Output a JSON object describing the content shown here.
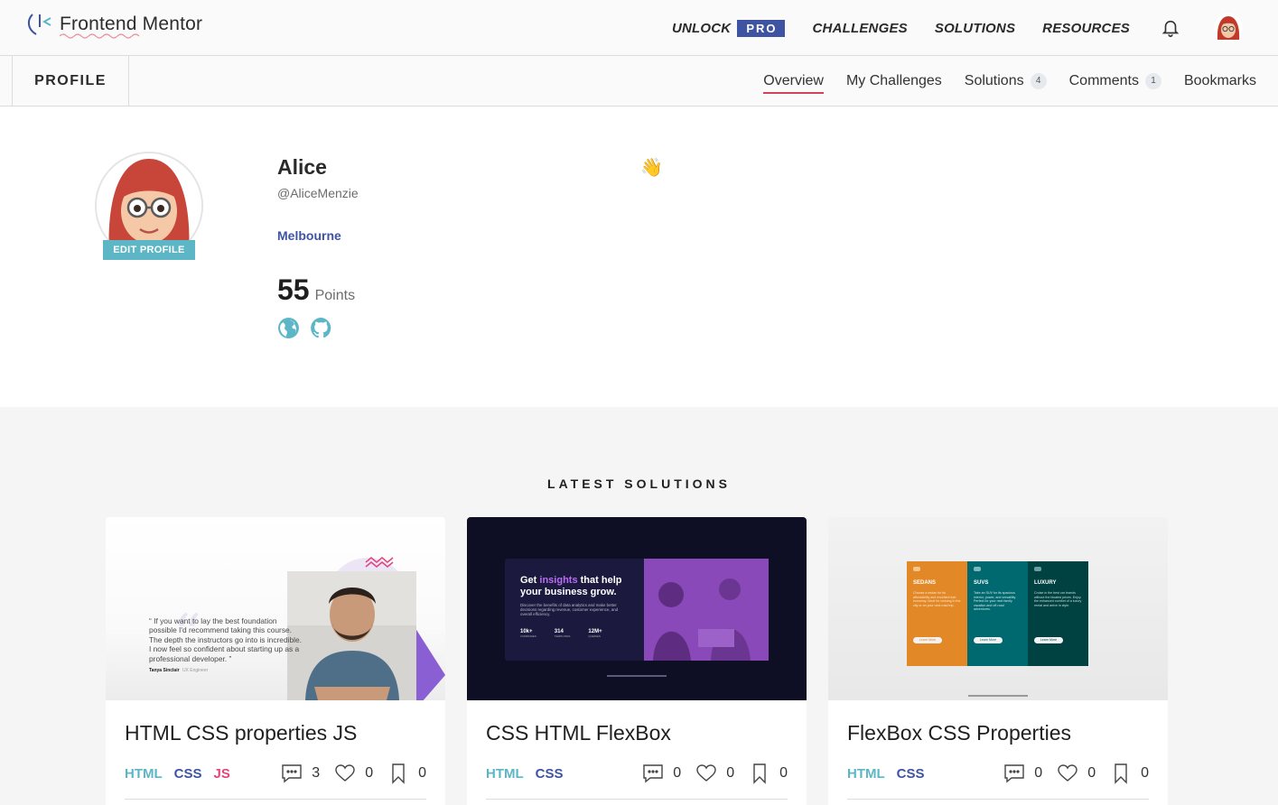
{
  "nav": {
    "logo_text": "Frontend Mentor",
    "unlock_label": "UNLOCK",
    "pro_label": "PRO",
    "challenges": "CHALLENGES",
    "solutions": "SOLUTIONS",
    "resources": "RESOURCES"
  },
  "subnav": {
    "profile_label": "PROFILE",
    "tabs": [
      {
        "label": "Overview",
        "active": true
      },
      {
        "label": "My Challenges"
      },
      {
        "label": "Solutions",
        "count": "4"
      },
      {
        "label": "Comments",
        "count": "1"
      },
      {
        "label": "Bookmarks"
      }
    ]
  },
  "profile": {
    "name": "Alice",
    "handle": "@AliceMenzie",
    "emoji": "👋",
    "location": "Melbourne",
    "points": "55",
    "points_label": "Points",
    "edit_label": "EDIT PROFILE"
  },
  "latest": {
    "title": "LATEST SOLUTIONS",
    "cards": [
      {
        "title": "HTML CSS properties JS",
        "tags": [
          "HTML",
          "CSS",
          "JS"
        ],
        "comments": "3",
        "likes": "0",
        "bookmarks": "0"
      },
      {
        "title": "CSS HTML FlexBox",
        "tags": [
          "HTML",
          "CSS"
        ],
        "comments": "0",
        "likes": "0",
        "bookmarks": "0"
      },
      {
        "title": "FlexBox CSS Properties",
        "tags": [
          "HTML",
          "CSS"
        ],
        "comments": "0",
        "likes": "0",
        "bookmarks": "0"
      }
    ],
    "thumb1": {
      "quote": "“ If you want to lay the best foundation possible I'd recommend taking this course. The depth the instructors go into is incredible. I now feel so confident about starting up as a professional developer. ”",
      "author": "Tanya Sinclair",
      "role": "UX Engineer"
    },
    "thumb2": {
      "heading_a": "Get ",
      "heading_b": "insights",
      "heading_c": " that help your business grow.",
      "body": "Discover the benefits of data analytics and make better decisions regarding revenue, customer experience, and overall efficiency.",
      "stats": [
        {
          "value": "10k+",
          "label": "COMPANIES"
        },
        {
          "value": "314",
          "label": "TEMPLATES"
        },
        {
          "value": "12M+",
          "label": "QUERIES"
        }
      ]
    },
    "thumb3": {
      "columns": [
        {
          "title": "SEDANS",
          "body": "Choose a sedan for its affordability and excellent fuel economy. Ideal for cruising in the city or on your next road trip.",
          "button": "Learn More"
        },
        {
          "title": "SUVS",
          "body": "Take an SUV for its spacious interior, power, and versatility. Perfect for your next family vacation and off-road adventures.",
          "button": "Learn More"
        },
        {
          "title": "LUXURY",
          "body": "Cruise in the best car brands without the bloated prices. Enjoy the enhanced comfort of a luxury rental and arrive in style.",
          "button": "Learn More"
        }
      ]
    }
  },
  "colors": {
    "accent_blue": "#3e54a3",
    "accent_teal": "#5cb6c6",
    "accent_pink": "#e3447c",
    "underline_red": "#d0425a"
  }
}
